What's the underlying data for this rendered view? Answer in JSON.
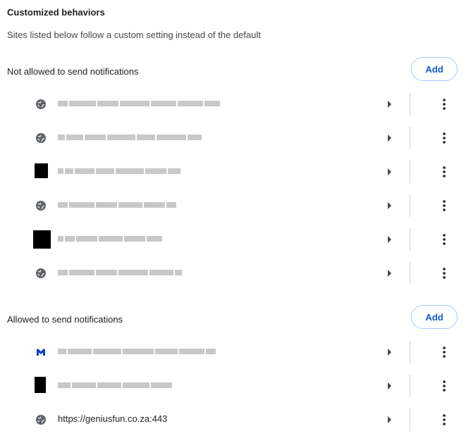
{
  "page": {
    "heading": "Customized behaviors",
    "description": "Sites listed below follow a custom setting instead of the default"
  },
  "blocked": {
    "label": "Not allowed to send notifications",
    "add_label": "Add",
    "sites": [
      {
        "icon": "globe-icon",
        "name": "",
        "redacted": true
      },
      {
        "icon": "globe-icon",
        "name": "",
        "redacted": true
      },
      {
        "icon": "site-favicon",
        "name": "",
        "redacted": true
      },
      {
        "icon": "globe-icon",
        "name": "",
        "redacted": true
      },
      {
        "icon": "site-favicon",
        "name": "",
        "redacted": true
      },
      {
        "icon": "globe-icon",
        "name": "",
        "redacted": true
      }
    ]
  },
  "allowed": {
    "label": "Allowed to send notifications",
    "add_label": "Add",
    "sites": [
      {
        "icon": "malwarebytes-icon",
        "name": "",
        "redacted": true
      },
      {
        "icon": "site-favicon",
        "name": "",
        "redacted": true
      },
      {
        "icon": "globe-icon",
        "name": "https://geniusfun.co.za:443",
        "redacted": false
      }
    ]
  },
  "colors": {
    "accent": "#0b57d0",
    "button_border": "#a8c7fa",
    "icon": "#474747"
  }
}
